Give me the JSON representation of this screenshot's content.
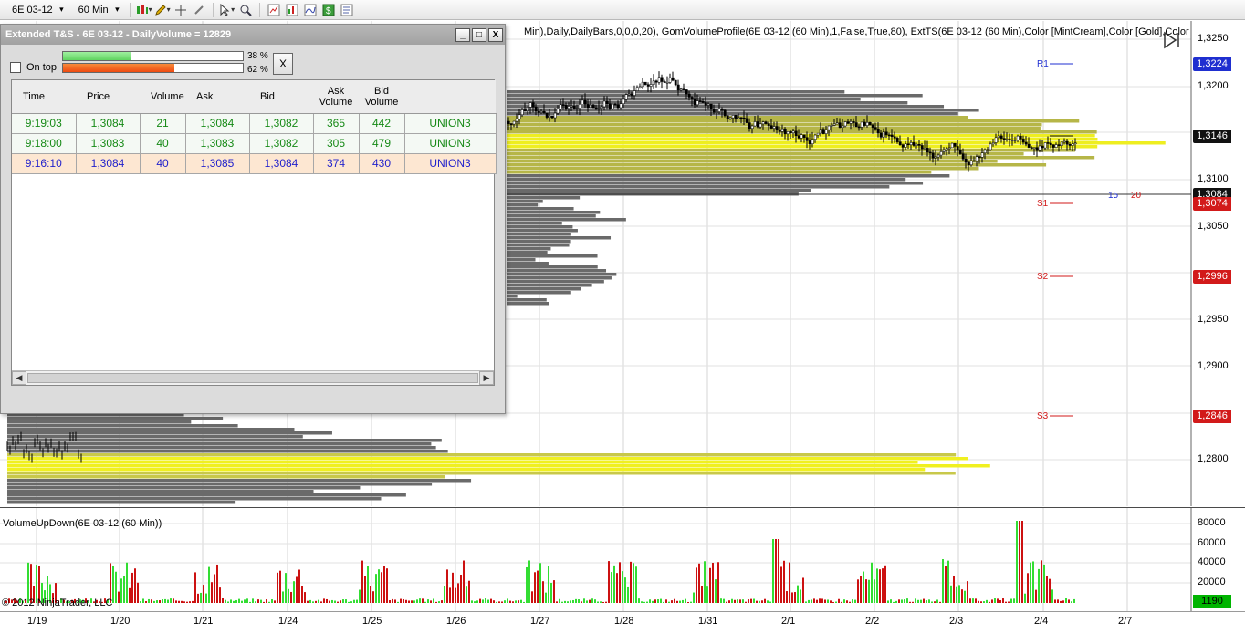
{
  "toolbar": {
    "instrument": "6E 03-12",
    "timeframe": "60 Min",
    "icons": [
      "candlestick-style-icon",
      "draw-pencil-icon",
      "crosshair-icon",
      "zoom-out-icon",
      "pointer-icon",
      "magnify-icon",
      "instrument-overlay-icon",
      "chart-trader-icon",
      "indicators-icon",
      "strategies-icon",
      "properties-icon"
    ]
  },
  "indicator_strip": "Min),Daily,DailyBars,0,0,0,20), GomVolumeProfile(6E 03-12 (60 Min),1,False,True,80), ExtTS(6E 03-12 (60 Min),Color [MintCream],Color [Gold],Color [",
  "price_axis": {
    "labels": [
      "1,3250",
      "1,3200",
      "1,3100",
      "1,3050",
      "1,2950",
      "1,2900",
      "1,2800"
    ],
    "tags": [
      {
        "value": "1,3224",
        "color": "#1f2fd0"
      },
      {
        "value": "1,3146",
        "color": "#111111"
      },
      {
        "value": "1,3084",
        "color": "#111111"
      },
      {
        "value": "1,3074",
        "color": "#d21a1a"
      },
      {
        "value": "1,2996",
        "color": "#d21a1a"
      },
      {
        "value": "1,2846",
        "color": "#d21a1a"
      }
    ]
  },
  "pivot_levels": [
    {
      "label": "R1",
      "color": "#1f2fd0"
    },
    {
      "label": "S1",
      "color": "#d21a1a"
    },
    {
      "label": "S2",
      "color": "#d21a1a"
    },
    {
      "label": "S3",
      "color": "#d21a1a"
    }
  ],
  "countdown": {
    "left": "15",
    "right": "20"
  },
  "volume_panel": {
    "title": "VolumeUpDown(6E 03-12 (60 Min))",
    "axis_labels": [
      "80000",
      "60000",
      "40000",
      "20000"
    ],
    "current_tag": "1190",
    "copyright": "© 2012 NinjaTrader, LLC"
  },
  "date_axis": [
    "1/19",
    "1/20",
    "1/21",
    "1/24",
    "1/25",
    "1/26",
    "1/27",
    "1/28",
    "1/31",
    "2/1",
    "2/2",
    "2/3",
    "2/4",
    "2/7"
  ],
  "ts_window": {
    "title": "Extended T&S - 6E 03-12 - DailyVolume = 12829",
    "minimize": "_",
    "maximize": "□",
    "close": "X",
    "on_top_label": "On top",
    "meters": [
      {
        "pct_label": "38 %",
        "fill": 0.38,
        "color": "#5fd35f"
      },
      {
        "pct_label": "62 %",
        "fill": 0.62,
        "color": "#ee4a10"
      }
    ],
    "x_button": "X",
    "columns": [
      "Time",
      "Price",
      "Volume",
      "Ask",
      "Bid",
      "Ask Volume",
      "Bid Volume",
      ""
    ],
    "rows": [
      {
        "style": "green",
        "cells": [
          "9:19:03",
          "1,3084",
          "21",
          "1,3084",
          "1,3082",
          "365",
          "442",
          "UNION3"
        ]
      },
      {
        "style": "green",
        "cells": [
          "9:18:00",
          "1,3083",
          "40",
          "1,3083",
          "1,3082",
          "305",
          "479",
          "UNION3"
        ]
      },
      {
        "style": "blue",
        "cells": [
          "9:16:10",
          "1,3084",
          "40",
          "1,3085",
          "1,3084",
          "374",
          "430",
          "UNION3"
        ]
      }
    ]
  }
}
